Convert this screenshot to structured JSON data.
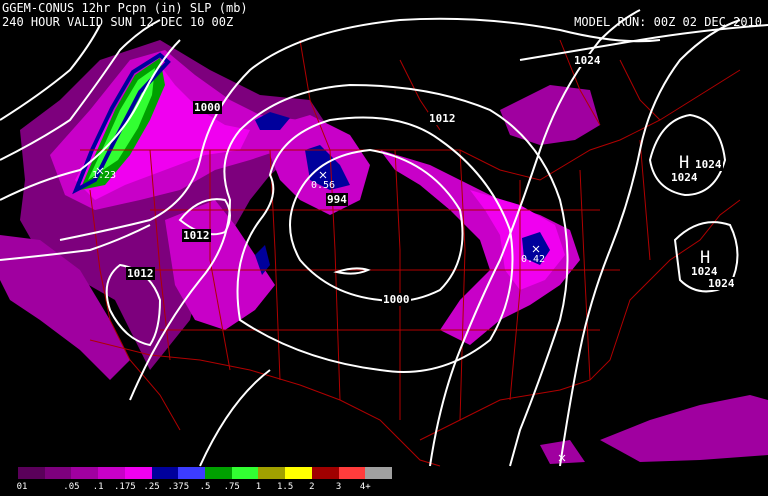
{
  "header": {
    "title_line1": "GGEM-CONUS 12hr Pcpn (in) SLP (mb)",
    "title_line2": "240 HOUR VALID SUN 12 DEC 10 00Z",
    "model_run": "MODEL RUN: 00Z 02 DEC 2010"
  },
  "isobar_labels": [
    "1024",
    "1000",
    "1012",
    "1012",
    "994",
    "1012",
    "1000",
    "1024",
    "1024",
    "1024",
    "1024"
  ],
  "pressure_centers": [
    "H",
    "H"
  ],
  "point_values": [
    "1.23",
    "0.56",
    "0.42"
  ],
  "legend": {
    "ticks": [
      "01",
      ".05",
      ".1",
      ".175",
      ".25",
      ".375",
      ".5",
      ".75",
      "1",
      "1.5",
      "2",
      "3",
      "4+"
    ],
    "colors": [
      "#5a005a",
      "#7d007d",
      "#a000a0",
      "#c800c8",
      "#f000f0",
      "#00009c",
      "#3c3cff",
      "#00a000",
      "#32ff32",
      "#a0a000",
      "#ffff00",
      "#a00000",
      "#ff3c3c",
      "#a0a0a0"
    ]
  },
  "colors": {
    "isobars": "#ffffff",
    "borders": "#b00000",
    "background": "#000000"
  }
}
